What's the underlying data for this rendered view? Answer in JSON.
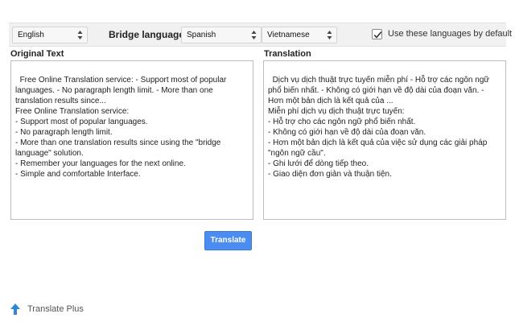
{
  "toolbar": {
    "source_language": "English",
    "bridge_label": "Bridge language",
    "bridge_language": "Spanish",
    "target_language": "Vietnamese",
    "default_checkbox_label": "Use these languages by default",
    "default_checked": true
  },
  "original": {
    "title": "Original Text",
    "text": "Free Online Translation service: - Support most of popular\nlanguages. - No paragraph length limit. - More than one\ntranslation results since...\nFree Online Translation service:\n- Support most of popular languages.\n- No paragraph length limit.\n- More than one translation results since using the \"bridge\nlanguage\" solution.\n- Remember your languages for the next online.\n- Simple and comfortable Interface."
  },
  "translation": {
    "title": "Translation",
    "text": "Dịch vụ dịch thuật trực tuyến miễn phí - Hỗ trợ các ngôn ngữ\nphổ biến nhất. - Không có giới hạn về độ dài của đoạn văn. -\nHơn một bản dịch là kết quả của ...\nMiễn phí dịch vụ dịch thuật trực tuyến:\n- Hỗ trợ cho các ngôn ngữ phổ biến nhất.\n- Không có giới hạn về độ dài của đoạn văn.\n- Hơn một bản dịch là kết quả của việc sử dụng các giải pháp\n\"ngôn ngữ cầu\".\n- Ghi lưới để dòng tiếp theo.\n- Giao diện đơn giản và thuận tiện."
  },
  "actions": {
    "translate_label": "Translate"
  },
  "brand": {
    "name": "Translate Plus"
  },
  "colors": {
    "accent": "#4a8cf0",
    "brand_icon": "#2f86d8"
  }
}
